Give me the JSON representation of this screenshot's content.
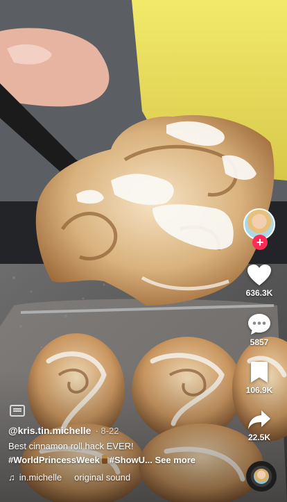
{
  "post": {
    "author": "@kris.tin.michelle",
    "date": "· 8-22",
    "caption": "Best cinnamon roll hack EVER!",
    "hashtag_1": "#WorldPrincessWeek",
    "hashtag_2": "#ShowU...",
    "see_more": "See more",
    "sound_author": "in.michelle",
    "sound_title": "original sound"
  },
  "actions": {
    "likes": "636.3K",
    "comments": "5857",
    "saves": "106.9K",
    "shares": "22.5K"
  },
  "icons": {
    "follow": "plus-icon",
    "like": "heart-icon",
    "comment": "comment-icon",
    "save": "bookmark-icon",
    "share": "share-arrow-icon",
    "music": "music-note-icon",
    "captions": "closed-captions-icon"
  },
  "colors": {
    "accent": "#fe2c55",
    "text": "#ffffff"
  }
}
